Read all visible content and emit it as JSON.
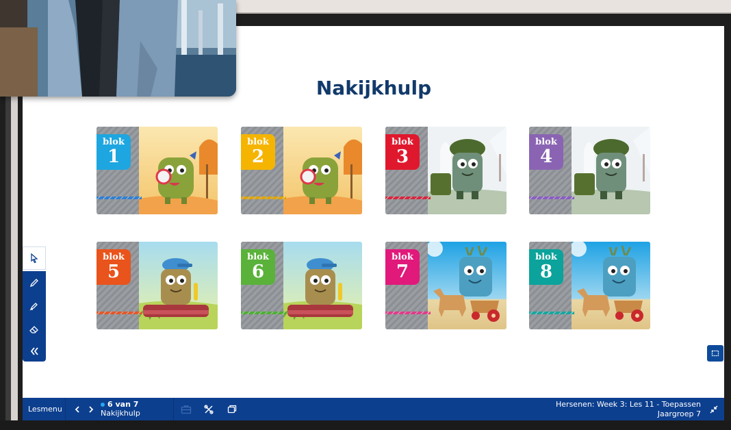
{
  "slide": {
    "title": "Nakijkhulp"
  },
  "tiles": [
    {
      "label": "blok",
      "number": "1",
      "color": "#1da6e0",
      "rope": "#2f7fd3",
      "scene": "lollipop"
    },
    {
      "label": "blok",
      "number": "2",
      "color": "#f5b400",
      "rope": "#e0a400",
      "scene": "lollipop"
    },
    {
      "label": "blok",
      "number": "3",
      "color": "#e0182d",
      "rope": "#d7263d",
      "scene": "soldier"
    },
    {
      "label": "blok",
      "number": "4",
      "color": "#8a64b3",
      "rope": "#8a5cc4",
      "scene": "soldier"
    },
    {
      "label": "blok",
      "number": "5",
      "color": "#e9531c",
      "rope": "#e4572a",
      "scene": "cap"
    },
    {
      "label": "blok",
      "number": "6",
      "color": "#5ab23a",
      "rope": "#4fae36",
      "scene": "cap"
    },
    {
      "label": "blok",
      "number": "7",
      "color": "#e0197b",
      "rope": "#e03b8a",
      "scene": "horse"
    },
    {
      "label": "blok",
      "number": "8",
      "color": "#0ba39b",
      "rope": "#18a6a0",
      "scene": "horse"
    }
  ],
  "toolbar": {
    "tools": [
      "select-icon",
      "pen-icon",
      "highlighter-icon",
      "eraser-icon",
      "collapse-icon"
    ]
  },
  "bottombar": {
    "lesmenu": "Lesmenu",
    "page_counter": "6 van 7",
    "page_name": "Nakijkhulp",
    "lesson": "Hersenen: Week 3: Les 11 - Toepassen",
    "group": "Jaargroep 7"
  },
  "colors": {
    "bar": "#0d3f8f",
    "title": "#123a6b",
    "dot": "#2aa4f4"
  }
}
